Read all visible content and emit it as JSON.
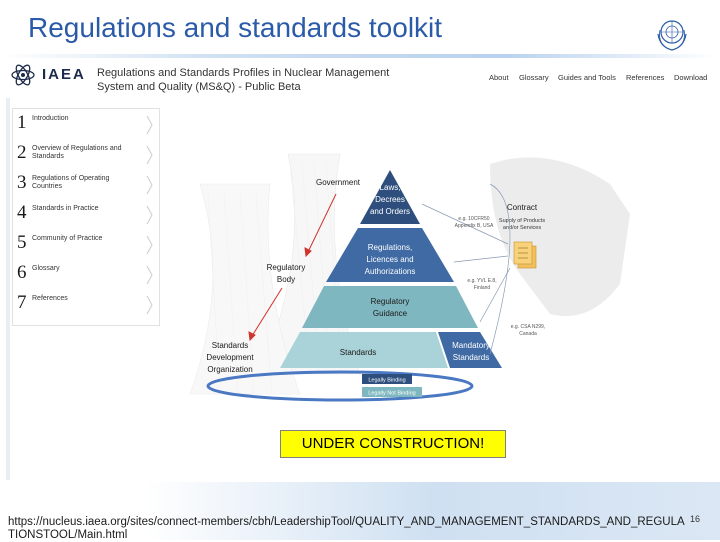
{
  "slide": {
    "title": "Regulations and standards toolkit",
    "footer_url": "https://nucleus.iaea.org/sites/connect-members/cbh/LeadershipTool/QUALITY_AND_MANAGEMENT_STANDARDS_AND_REGULATIONSTOOL/Main.html",
    "page_number": "16",
    "banner": "UNDER CONSTRUCTION!"
  },
  "site": {
    "brand": "IAEA",
    "title_line1": "Regulations and Standards Profiles in Nuclear Management",
    "title_line2": "System and Quality (MS&Q) - Public Beta",
    "nav": [
      "About",
      "Glossary",
      "Guides and Tools",
      "References",
      "Download"
    ]
  },
  "sidebar": {
    "items": [
      {
        "num": "1",
        "label": "Introduction"
      },
      {
        "num": "2",
        "label": "Overview of Regulations and Standards"
      },
      {
        "num": "3",
        "label": "Regulations of Operating Countries"
      },
      {
        "num": "4",
        "label": "Standards in Practice"
      },
      {
        "num": "5",
        "label": "Community of Practice"
      },
      {
        "num": "6",
        "label": "Glossary"
      },
      {
        "num": "7",
        "label": "References"
      }
    ]
  },
  "diagram": {
    "government": "Government",
    "regulatory_body_1": "Regulatory",
    "regulatory_body_2": "Body",
    "sdo_1": "Standards",
    "sdo_2": "Development",
    "sdo_3": "Organization",
    "contract": "Contract",
    "supply_1": "Supply of Products",
    "supply_2": "and/or Services",
    "level1_a": "Laws,",
    "level1_b": "Decrees",
    "level1_c": "and Orders",
    "level2_a": "Regulations,",
    "level2_b": "Licences and",
    "level2_c": "Authorizations",
    "level3_a": "Regulatory",
    "level3_b": "Guidance",
    "level4_standards": "Standards",
    "level4_mand_a": "Mandatory",
    "level4_mand_b": "Standards",
    "eg1_a": "e.g. 10CFR50",
    "eg1_b": "Appendix B, USA",
    "eg2_a": "e.g. YVL E.8,",
    "eg2_b": "Finland",
    "eg3_a": "e.g. CSA N299,",
    "eg3_b": "Canada",
    "legal_1": "Legally Binding",
    "legal_2": "Legally Not Binding"
  },
  "colors": {
    "title_blue": "#2b5ba8",
    "pyramid_top": "#2e4f7e",
    "pyramid_mid": "#3f6aa3",
    "pyramid_low": "#7fb7c0",
    "pyramid_base": "#a9d3d8",
    "banner_yellow": "#ffff00",
    "arrow_red": "#d0342c"
  }
}
